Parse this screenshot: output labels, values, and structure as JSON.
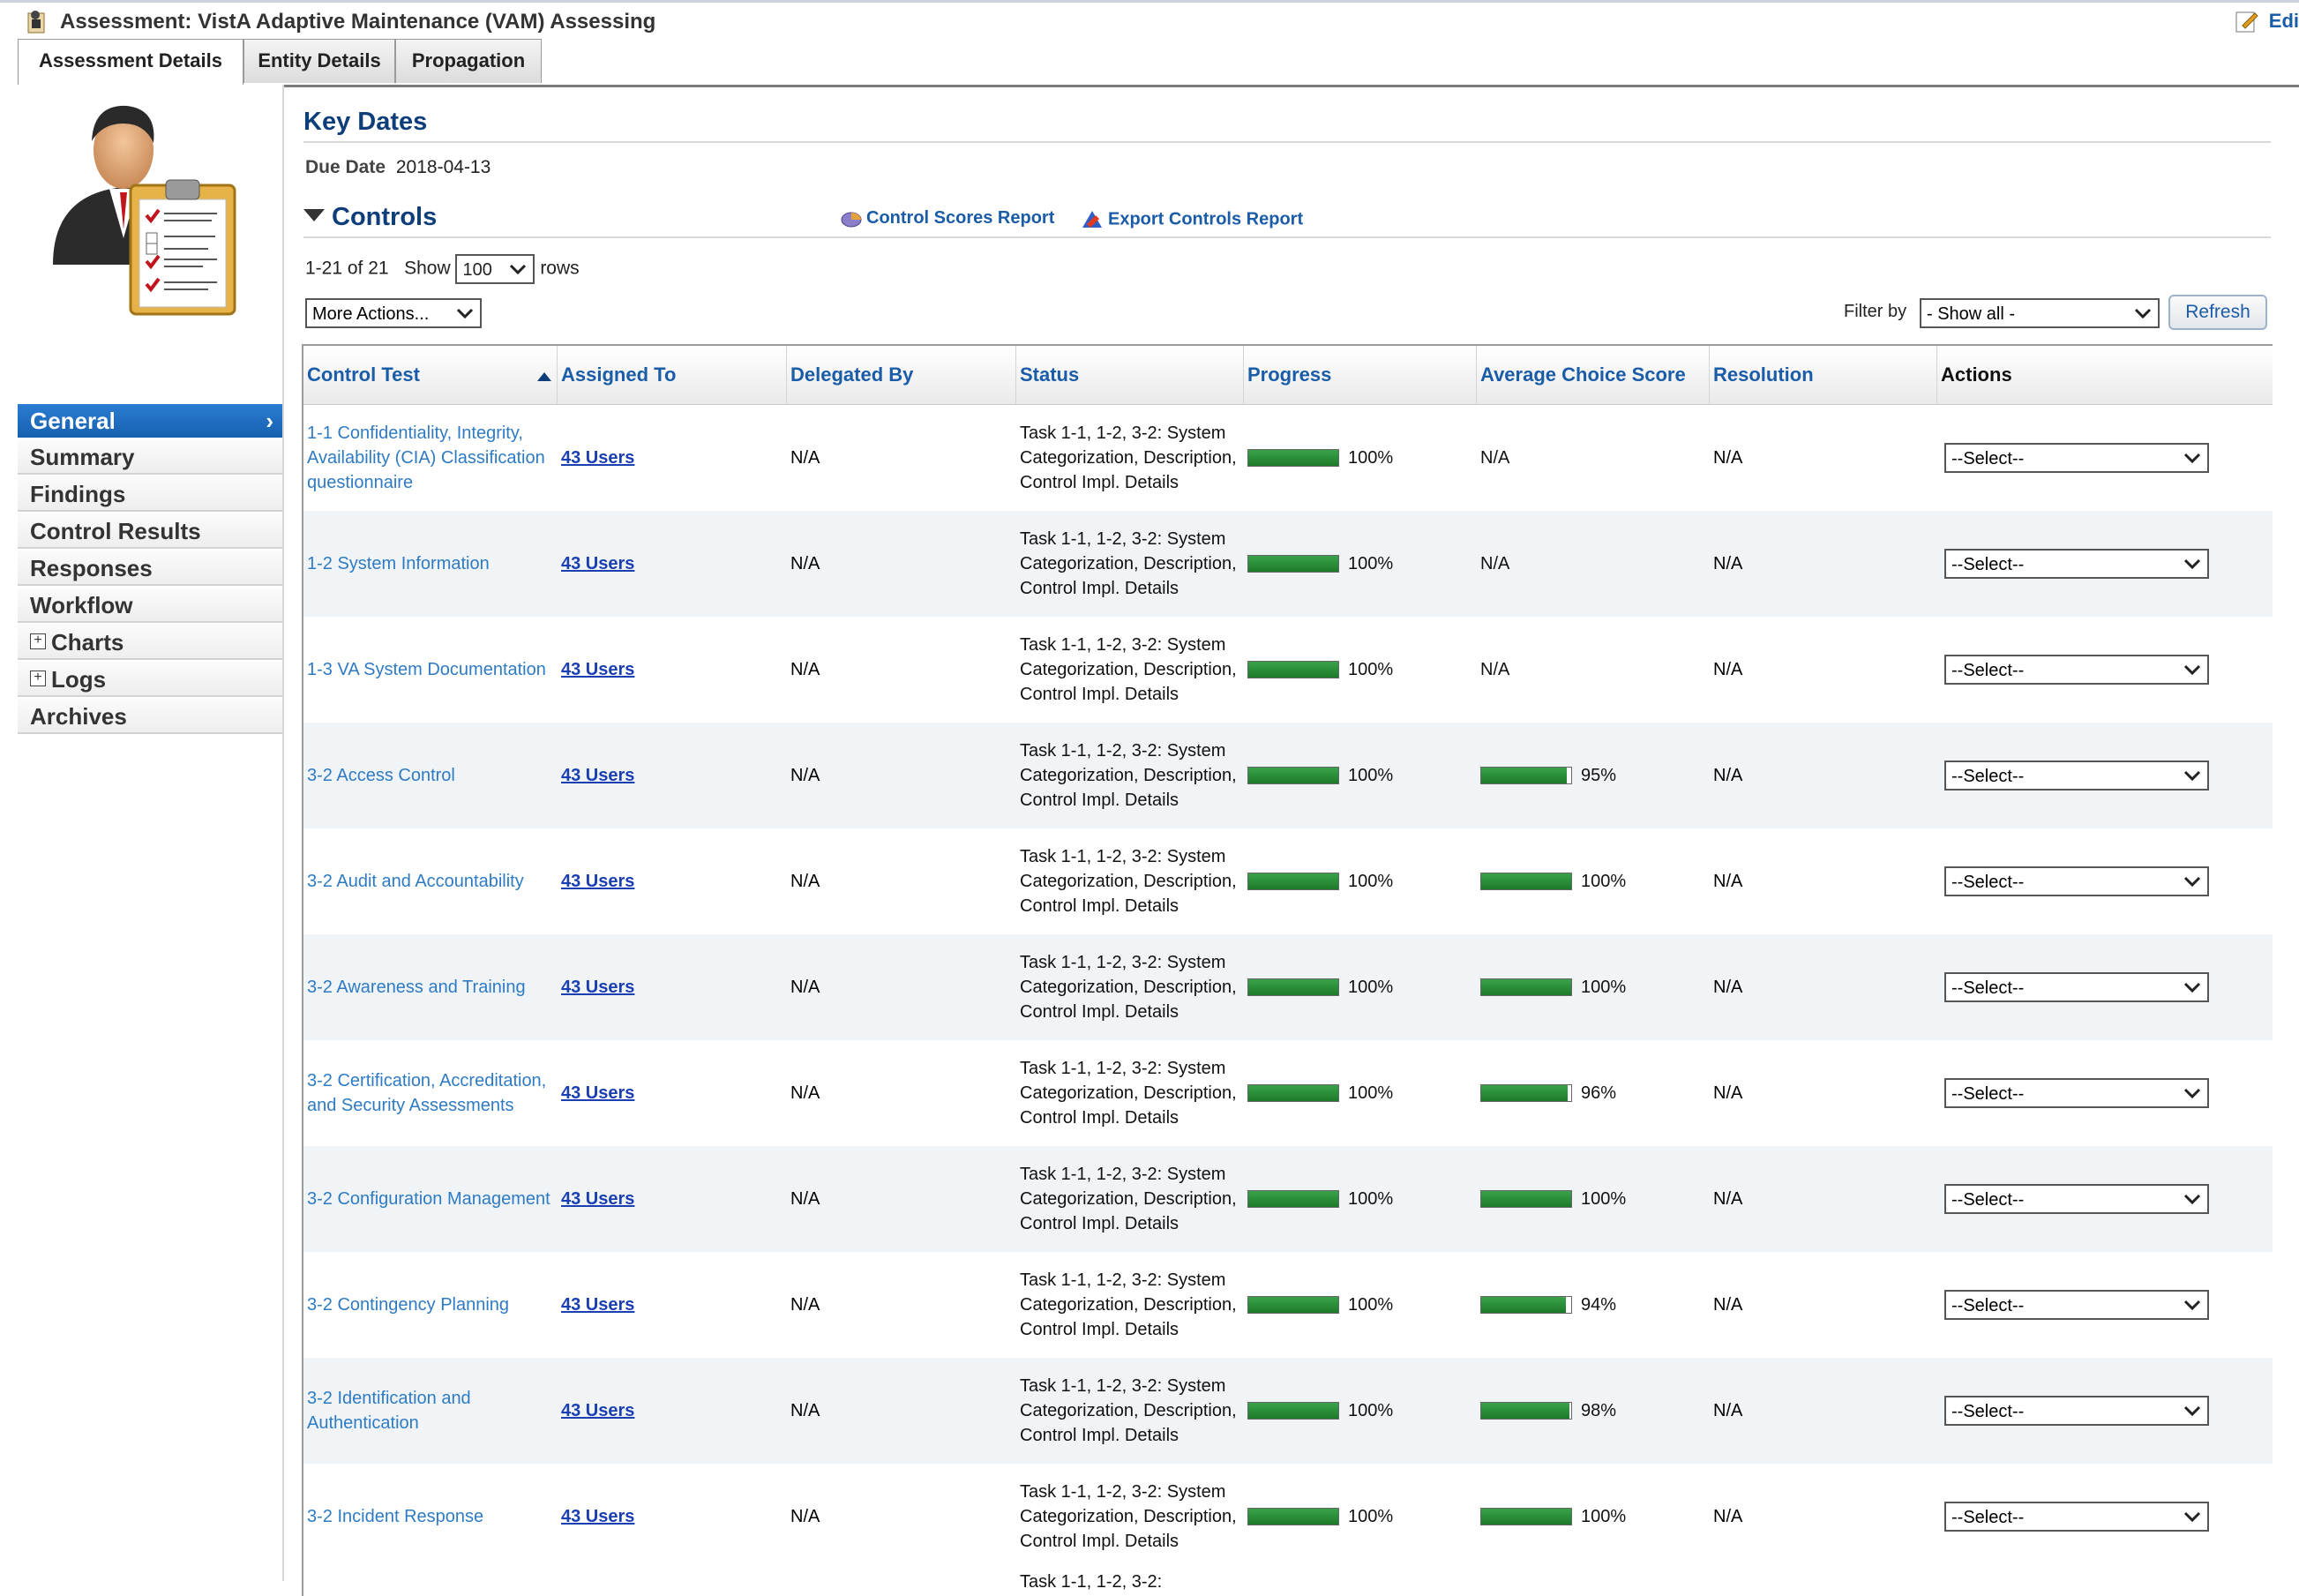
{
  "window": {
    "title": "Assessment: VistA Adaptive Maintenance (VAM) Assessing",
    "edit_label": "Edi"
  },
  "tabs": [
    "Assessment Details",
    "Entity Details",
    "Propagation"
  ],
  "sidebar": {
    "general_label": "General",
    "items": [
      "Summary",
      "Findings",
      "Control Results",
      "Responses",
      "Workflow",
      "Charts",
      "Logs",
      "Archives"
    ]
  },
  "main": {
    "key_dates_title": "Key Dates",
    "due_date_label": "Due Date",
    "due_date_value": "2018-04-13",
    "controls_title": "Controls",
    "control_scores_report": "Control Scores Report",
    "export_controls_report": "Export Controls Report",
    "pager_range": "1-21 of 21",
    "show_label": "Show",
    "rows_value": "100",
    "rows_label": "rows",
    "more_actions": "More Actions...",
    "filter_label": "Filter by",
    "filter_value": "- Show all -",
    "refresh_label": "Refresh"
  },
  "table": {
    "headers": [
      "Control Test",
      "Assigned To",
      "Delegated By",
      "Status",
      "Progress",
      "Average Choice Score",
      "Resolution",
      "Actions"
    ],
    "rows": [
      {
        "control": "1-1 Confidentiality, Integrity, Availability (CIA) Classification questionnaire",
        "assigned": "43 Users",
        "delegated": "N/A",
        "status": "Task 1-1, 1-2, 3-2: System Categorization, Description, Control Impl. Details",
        "progress": 100,
        "progress_text": "100%",
        "score": null,
        "score_text": "N/A",
        "resolution": "N/A",
        "action": "--Select--"
      },
      {
        "control": "1-2 System Information",
        "assigned": "43 Users",
        "delegated": "N/A",
        "status": "Task 1-1, 1-2, 3-2: System Categorization, Description, Control Impl. Details",
        "progress": 100,
        "progress_text": "100%",
        "score": null,
        "score_text": "N/A",
        "resolution": "N/A",
        "action": "--Select--"
      },
      {
        "control": "1-3 VA System Documentation",
        "assigned": "43 Users",
        "delegated": "N/A",
        "status": "Task 1-1, 1-2, 3-2: System Categorization, Description, Control Impl. Details",
        "progress": 100,
        "progress_text": "100%",
        "score": null,
        "score_text": "N/A",
        "resolution": "N/A",
        "action": "--Select--"
      },
      {
        "control": "3-2 Access Control",
        "assigned": "43 Users",
        "delegated": "N/A",
        "status": "Task 1-1, 1-2, 3-2: System Categorization, Description, Control Impl. Details",
        "progress": 100,
        "progress_text": "100%",
        "score": 95,
        "score_text": "95%",
        "resolution": "N/A",
        "action": "--Select--"
      },
      {
        "control": "3-2 Audit and Accountability",
        "assigned": "43 Users",
        "delegated": "N/A",
        "status": "Task 1-1, 1-2, 3-2: System Categorization, Description, Control Impl. Details",
        "progress": 100,
        "progress_text": "100%",
        "score": 100,
        "score_text": "100%",
        "resolution": "N/A",
        "action": "--Select--"
      },
      {
        "control": "3-2 Awareness and Training",
        "assigned": "43 Users",
        "delegated": "N/A",
        "status": "Task 1-1, 1-2, 3-2: System Categorization, Description, Control Impl. Details",
        "progress": 100,
        "progress_text": "100%",
        "score": 100,
        "score_text": "100%",
        "resolution": "N/A",
        "action": "--Select--"
      },
      {
        "control": "3-2 Certification, Accreditation, and Security Assessments",
        "assigned": "43 Users",
        "delegated": "N/A",
        "status": "Task 1-1, 1-2, 3-2: System Categorization, Description, Control Impl. Details",
        "progress": 100,
        "progress_text": "100%",
        "score": 96,
        "score_text": "96%",
        "resolution": "N/A",
        "action": "--Select--"
      },
      {
        "control": "3-2 Configuration Management",
        "assigned": "43 Users",
        "delegated": "N/A",
        "status": "Task 1-1, 1-2, 3-2: System Categorization, Description, Control Impl. Details",
        "progress": 100,
        "progress_text": "100%",
        "score": 100,
        "score_text": "100%",
        "resolution": "N/A",
        "action": "--Select--"
      },
      {
        "control": "3-2 Contingency Planning",
        "assigned": "43 Users",
        "delegated": "N/A",
        "status": "Task 1-1, 1-2, 3-2: System Categorization, Description, Control Impl. Details",
        "progress": 100,
        "progress_text": "100%",
        "score": 94,
        "score_text": "94%",
        "resolution": "N/A",
        "action": "--Select--"
      },
      {
        "control": "3-2 Identification and Authentication",
        "assigned": "43 Users",
        "delegated": "N/A",
        "status": "Task 1-1, 1-2, 3-2: System Categorization, Description, Control Impl. Details",
        "progress": 100,
        "progress_text": "100%",
        "score": 98,
        "score_text": "98%",
        "resolution": "N/A",
        "action": "--Select--"
      },
      {
        "control": "3-2 Incident Response",
        "assigned": "43 Users",
        "delegated": "N/A",
        "status": "Task 1-1, 1-2, 3-2: System Categorization, Description, Control Impl. Details",
        "progress": 100,
        "progress_text": "100%",
        "score": 100,
        "score_text": "100%",
        "resolution": "N/A",
        "action": "--Select--"
      }
    ],
    "partial_row_status": "Task 1-1, 1-2, 3-2:"
  },
  "colors": {
    "link_blue": "#2e7bc4",
    "heading_navy": "#0e3e7a",
    "nav_active": "#1660b0",
    "bar_green": "#1d7a2b"
  },
  "icons": {
    "app": "assessment-icon",
    "edit": "edit-icon",
    "control_scores": "report-icon",
    "export": "export-icon",
    "sort": "sort-ascending-icon"
  }
}
